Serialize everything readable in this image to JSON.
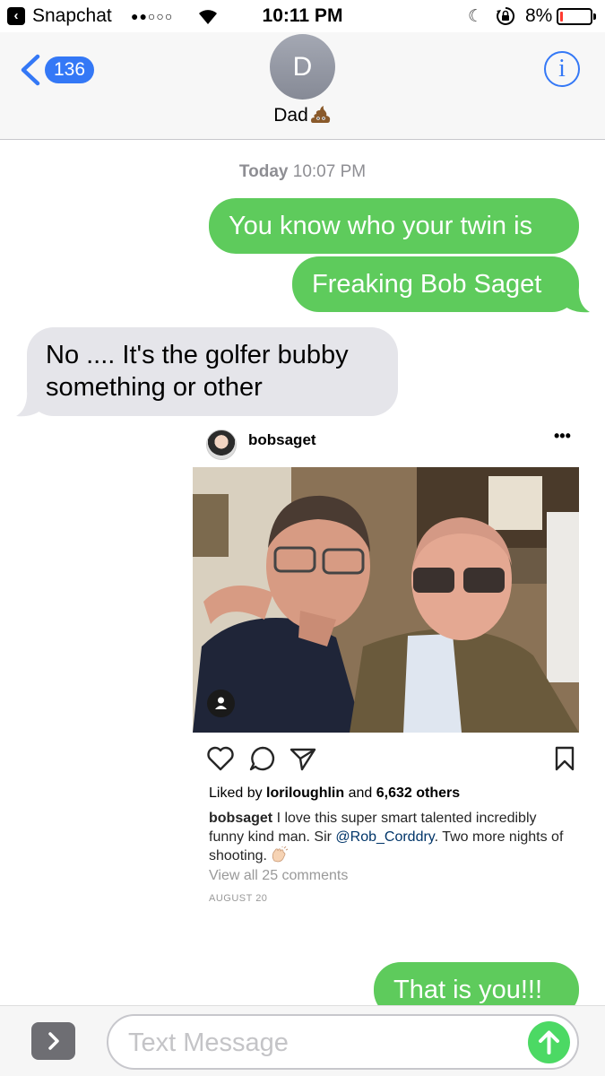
{
  "status_bar": {
    "back_app": "Snapchat",
    "signal": "●●○○○",
    "time": "10:11 PM",
    "battery_text": "8%",
    "battery_level": 0.08,
    "battery_color": "#ff3b30"
  },
  "nav": {
    "back_count": "136",
    "avatar_initial": "D",
    "contact_name": "Dad",
    "info_glyph": "i",
    "accent": "#3478f6"
  },
  "conversation": {
    "timestamp_day": "Today",
    "timestamp_time": "10:07 PM",
    "outgoing_color": "#5ecb5c",
    "incoming_color": "#e5e5ea",
    "messages": [
      {
        "direction": "outgoing",
        "text": "You know who your twin is"
      },
      {
        "direction": "outgoing",
        "text": "Freaking Bob Saget"
      },
      {
        "direction": "incoming",
        "text": "No .... It's the golfer bubby something or other"
      },
      {
        "direction": "outgoing",
        "text": "That is you!!!"
      }
    ]
  },
  "instagram_post": {
    "username": "bobsaget",
    "more_glyph": "•••",
    "liked_prefix": "Liked by",
    "liked_user": "loriloughlin",
    "liked_and": "and",
    "liked_others": "6,632 others",
    "caption_user": "bobsaget",
    "caption_text": "I love this super smart talented incredibly funny kind man. Sir",
    "caption_mention": "@Rob_Corddry",
    "caption_tail": ". Two more nights of shooting.",
    "view_comments": "View all 25 comments",
    "date": "AUGUST 20"
  },
  "input_bar": {
    "placeholder": "Text Message"
  }
}
